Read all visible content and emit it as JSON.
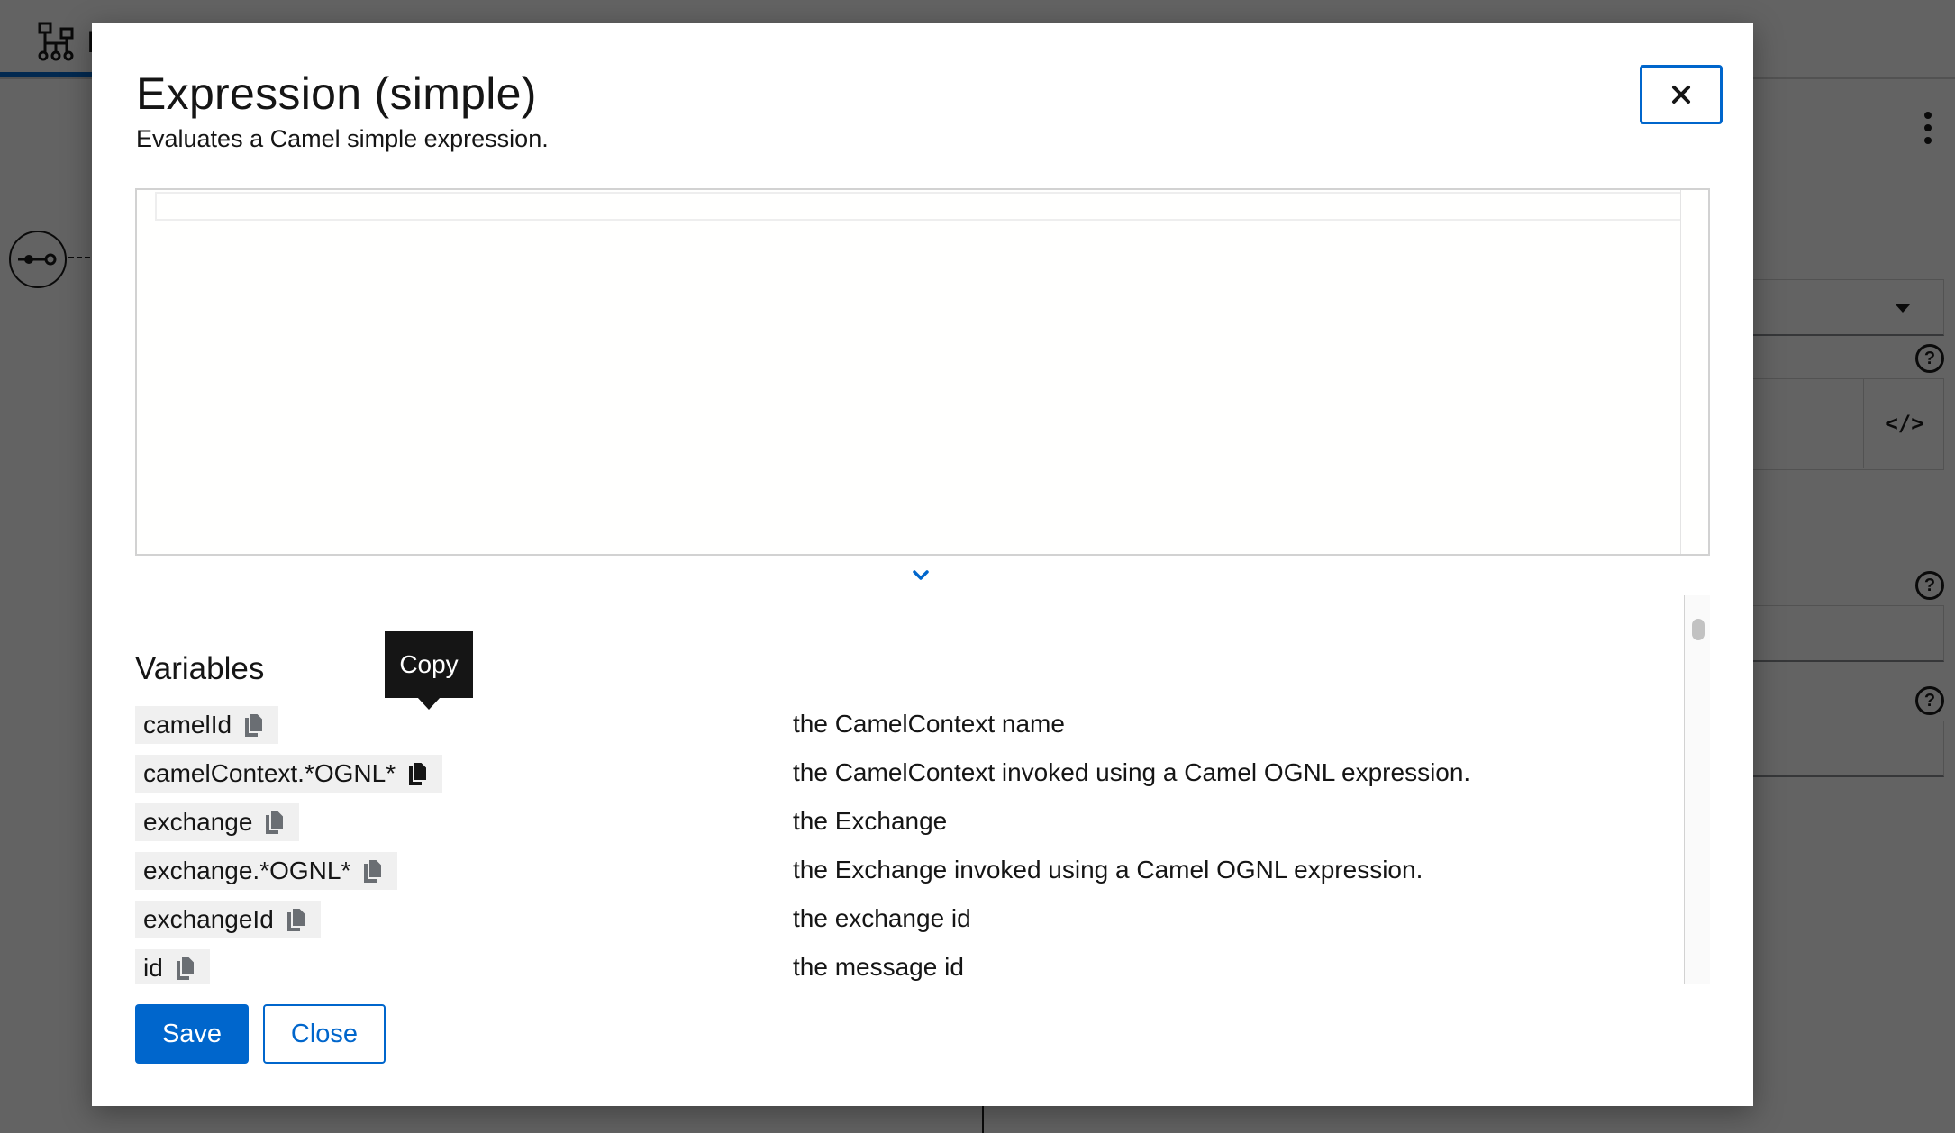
{
  "background": {
    "toolbar_label": "I"
  },
  "modal": {
    "title": "Expression (simple)",
    "description": "Evaluates a Camel simple expression.",
    "editor": {
      "content": ""
    },
    "variables": {
      "heading": "Variables",
      "items": [
        {
          "name": "camelId",
          "description": "the CamelContext name"
        },
        {
          "name": "camelContext.*OGNL*",
          "description": "the CamelContext invoked using a Camel OGNL expression."
        },
        {
          "name": "exchange",
          "description": "the Exchange"
        },
        {
          "name": "exchange.*OGNL*",
          "description": "the Exchange invoked using a Camel OGNL expression."
        },
        {
          "name": "exchangeId",
          "description": "the exchange id"
        },
        {
          "name": "id",
          "description": "the message id"
        }
      ]
    },
    "tooltip": {
      "text": "Copy"
    },
    "buttons": {
      "save": "Save",
      "close": "Close"
    }
  },
  "colors": {
    "primary": "#0066cc",
    "text": "#151515",
    "chip_bg": "#f0f0f0"
  },
  "icons": [
    "topology-icon",
    "close-icon",
    "chevron-down-icon",
    "copy-icon",
    "kebab-icon",
    "help-icon",
    "code-icon",
    "caret-down-icon",
    "route-start-icon"
  ]
}
